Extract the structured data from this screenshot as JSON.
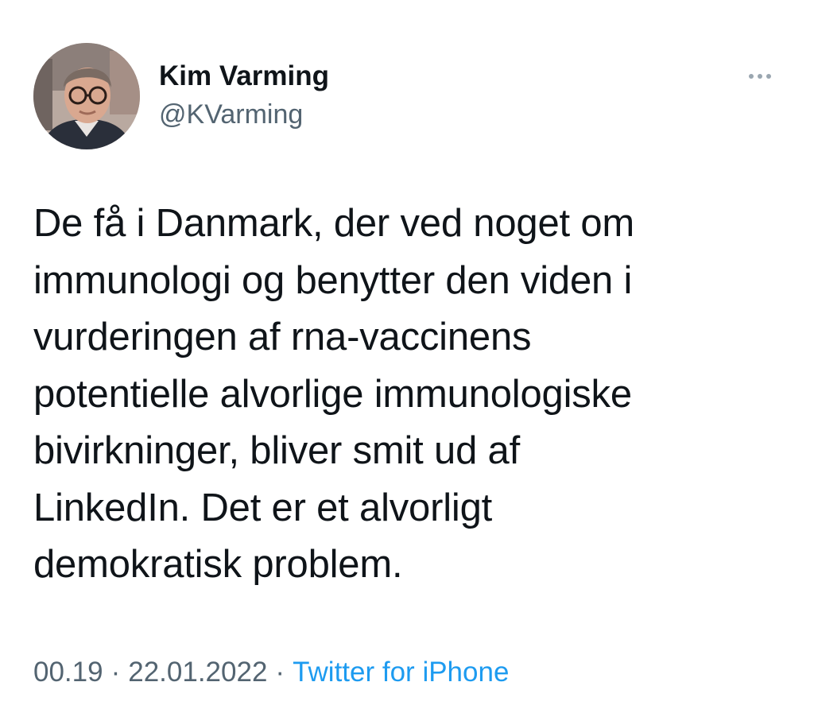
{
  "tweet": {
    "author": {
      "display_name": "Kim Varming",
      "handle": "@KVarming",
      "avatar_icon": "user-avatar-photo"
    },
    "more_icon": "more-horizontal-icon",
    "text": "De få i Danmark, der ved noget om\nimmunologi og benytter den viden i\nvurderingen af rna-vaccinens\npotentielle alvorlige immunologiske\nbivirkninger, bliver  smit ud af\nLinkedIn. Det er et alvorligt\ndemokratisk problem.",
    "time": "00.19",
    "separator": "·",
    "date": "22.01.2022",
    "source": "Twitter for iPhone"
  },
  "colors": {
    "text": "#0f1419",
    "muted": "#536471",
    "link": "#1d9bf0"
  }
}
